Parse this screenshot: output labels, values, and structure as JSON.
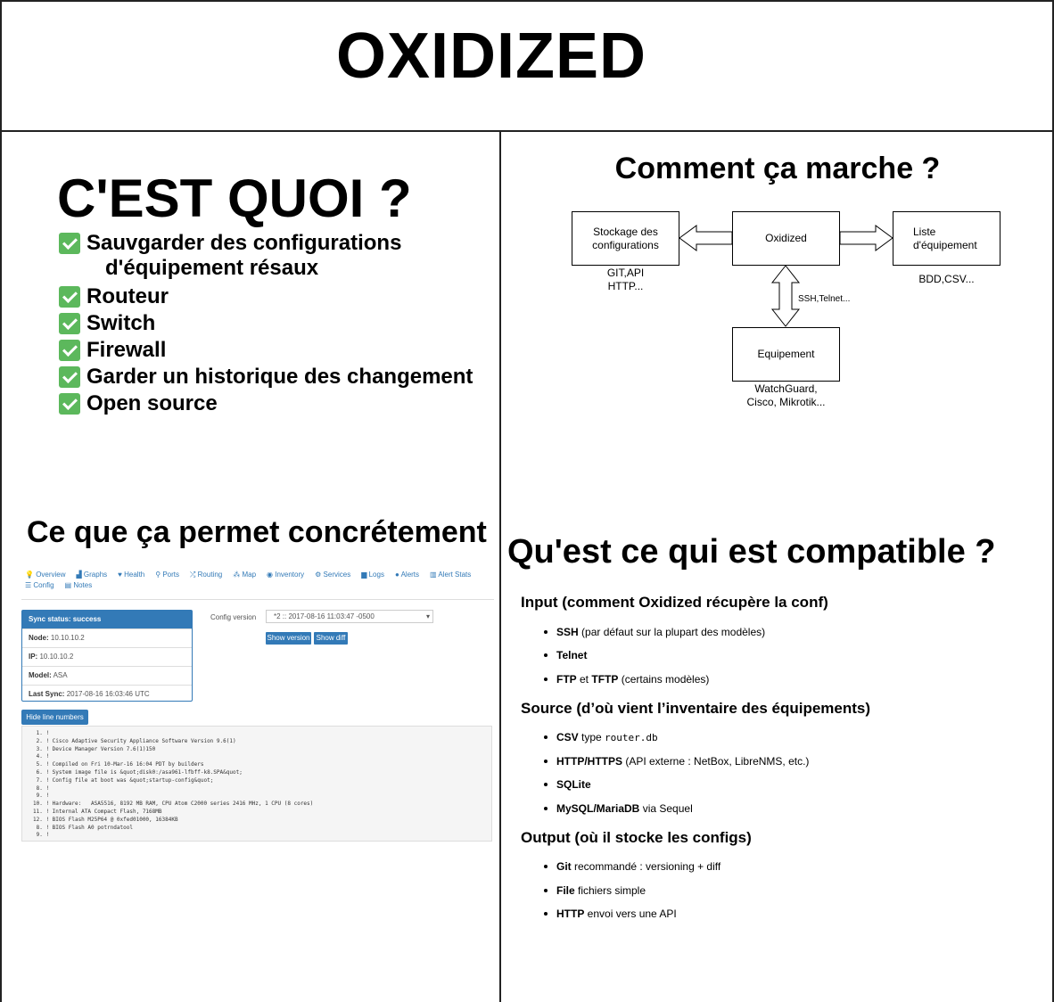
{
  "title": "OXIDIZED",
  "quoi": {
    "title": "C'EST QUOI ?",
    "items": [
      "Sauvgarder des configurations",
      "Routeur",
      "Switch",
      "Firewall",
      "Garder un historique des changement",
      "Open source"
    ],
    "item1_cont": "d'équipement résaux"
  },
  "marche": {
    "title": "Comment ça marche ?",
    "nodes": {
      "storage": [
        "Stockage des",
        "configurations"
      ],
      "oxidized": "Oxidized",
      "list": [
        "Liste",
        "d'équipement"
      ],
      "equip": "Equipement"
    },
    "labels": {
      "storage": [
        "GIT,API",
        "HTTP..."
      ],
      "list": "BDD,CSV...",
      "link": "SSH,Telnet...",
      "equip": [
        "WatchGuard,",
        "Cisco, Mikrotik..."
      ]
    }
  },
  "permet": {
    "title": "Ce que ça permet concrétement",
    "nav": [
      "Overview",
      "Graphs",
      "Health",
      "Ports",
      "Routing",
      "Map",
      "Inventory",
      "Services",
      "Logs",
      "Alerts",
      "Alert Stats",
      "Config",
      "Notes"
    ],
    "panel": {
      "header": "Sync status: success",
      "rows": [
        {
          "k": "Node:",
          "v": "10.10.10.2"
        },
        {
          "k": "IP:",
          "v": "10.10.10.2"
        },
        {
          "k": "Model:",
          "v": "ASA"
        },
        {
          "k": "Last Sync:",
          "v": "2017-08-16 16:03:46 UTC"
        }
      ]
    },
    "config_label": "Config version",
    "config_value": "*2 :: 2017-08-16 11:03:47 -0500",
    "show_version": "Show version",
    "show_diff": "Show diff",
    "hide_lines": "Hide line numbers",
    "code": [
      " 1. !",
      " 2. ! Cisco Adaptive Security Appliance Software Version 9.6(1)",
      " 3. ! Device Manager Version 7.6(1)150",
      " 4. !",
      " 5. ! Compiled on Fri 10-Mar-16 16:04 PDT by builders",
      " 6. ! System image file is &quot;disk0:/asa961-lfbff-k8.SPA&quot;",
      " 7. ! Config file at boot was &quot;startup-config&quot;",
      " 8. !",
      " 9. !",
      "10. ! Hardware:   ASA5516, 8192 MB RAM, CPU Atom C2000 series 2416 MHz, 1 CPU (8 cores)",
      "11. ! Internal ATA Compact Flash, 7168MB",
      "12. ! BIOS Flash M25P64 @ 0xfed01000, 16384KB",
      " 8. ! BIOS Flash A0 potrndatool",
      " 9. !"
    ]
  },
  "compat": {
    "title": "Qu'est ce qui est compatible ?",
    "input": {
      "heading": "Input (comment Oxidized récupère la conf)",
      "items": [
        {
          "b": "SSH",
          "t": " (par défaut sur la plupart des modèles)"
        },
        {
          "b": "Telnet",
          "t": ""
        },
        {
          "b": "FTP",
          "m": " et ",
          "b2": "TFTP",
          "t": " (certains modèles)"
        }
      ]
    },
    "source": {
      "heading": "Source (d’où vient l’inventaire des équipements)",
      "items": [
        {
          "b": "CSV",
          "t": " type ",
          "code": "router.db"
        },
        {
          "b": "HTTP/HTTPS",
          "t": " (API externe : NetBox, LibreNMS, etc.)"
        },
        {
          "b": "SQLite",
          "t": ""
        },
        {
          "b": "MySQL/MariaDB",
          "t": " via Sequel"
        }
      ]
    },
    "output": {
      "heading": "Output (où il stocke les configs)",
      "items": [
        {
          "b": "Git",
          "t": " recommandé : versioning + diff"
        },
        {
          "b": "File",
          "t": " fichiers simple"
        },
        {
          "b": "HTTP",
          "t": " envoi vers une API"
        }
      ]
    }
  }
}
